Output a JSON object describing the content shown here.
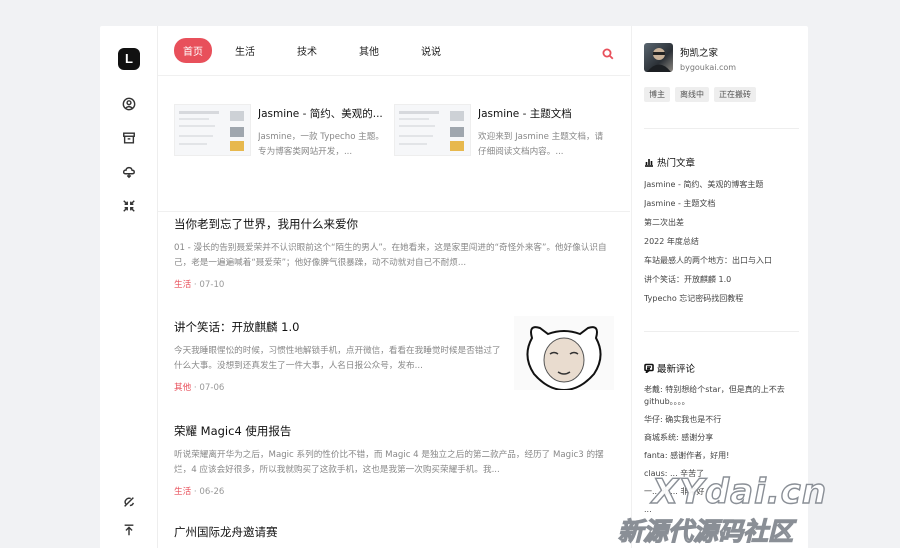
{
  "rail": {
    "logo": "L",
    "icons": [
      "user-circle-icon",
      "archive-icon",
      "cloud-icon",
      "collapse-icon"
    ],
    "bottom_icons": [
      "theme-toggle-icon",
      "back-to-top-icon"
    ]
  },
  "nav": {
    "tabs": [
      "首页",
      "生活",
      "技术",
      "其他",
      "说说"
    ],
    "active": "首页",
    "search_icon": "search-icon",
    "accent": "#e8505b"
  },
  "featured": [
    {
      "title": "Jasmine - 简约、美观的...",
      "desc": "Jasmine，一款 Typecho 主题。专为博客类网站开发，..."
    },
    {
      "title": "Jasmine - 主题文档",
      "desc": "欢迎来到 Jasmine 主题文档，请仔细阅读文档内容。..."
    }
  ],
  "posts": [
    {
      "title": "当你老到忘了世界，我用什么来爱你",
      "excerpt": "01 - 漫长的告别聂爱荣并不认识眼前这个“陌生的男人”。在她看来，这是家里闯进的“奇怪外来客”。他好像认识自己，老是一遍遍喊着“聂爱荣”；他好像脾气很暴躁，动不动就对自己不耐烦...",
      "category": "生活",
      "date": "07-10"
    },
    {
      "title": "讲个笑话：开放麒麟 1.0",
      "excerpt": "今天我睡眼惺忪的时候，习惯性地解锁手机，点开微信，看看在我睡觉时候是否错过了什么大事。没想到还真发生了一件大事，人名日报公众号，发布...",
      "category": "其他",
      "date": "07-06"
    },
    {
      "title": "荣耀 Magic4 使用报告",
      "excerpt": "听说荣耀离开华为之后，Magic 系列的性价比不错，而 Magic 4 是独立之后的第二款产品，经历了 Magic3 的摆烂，4 应该会好很多，所以我就购买了这款手机，这也是我第一次购买荣耀手机。我...",
      "category": "生活",
      "date": "06-26"
    },
    {
      "title": "广州国际龙舟邀请赛"
    }
  ],
  "sidebar": {
    "site_name": "狗凯之家",
    "site_url": "bygoukai.com",
    "tags": [
      "博主",
      "离线中",
      "正在搬砖"
    ],
    "hot_title": "热门文章",
    "hot": [
      "Jasmine - 简约、美观的博客主题",
      "Jasmine - 主题文档",
      "第二次出差",
      "2022 年度总结",
      "车站最感人的两个地方：出口与入口",
      "讲个笑话：开放麒麟 1.0",
      "Typecho 忘记密码找回教程"
    ],
    "comments_title": "最新评论",
    "comments": [
      "老戴: 特别想给个star，但是真的上不去github。。。。",
      "华仔: 确实我也是不行",
      "商城系统: 感谢分享",
      "fanta: 感谢作者，好用!",
      "claus: ... 辛苦了",
      "一... 很... 非常好",
      "..."
    ]
  },
  "watermark": {
    "top": "XYdai.cn",
    "bottom": "新源代源码社区"
  }
}
